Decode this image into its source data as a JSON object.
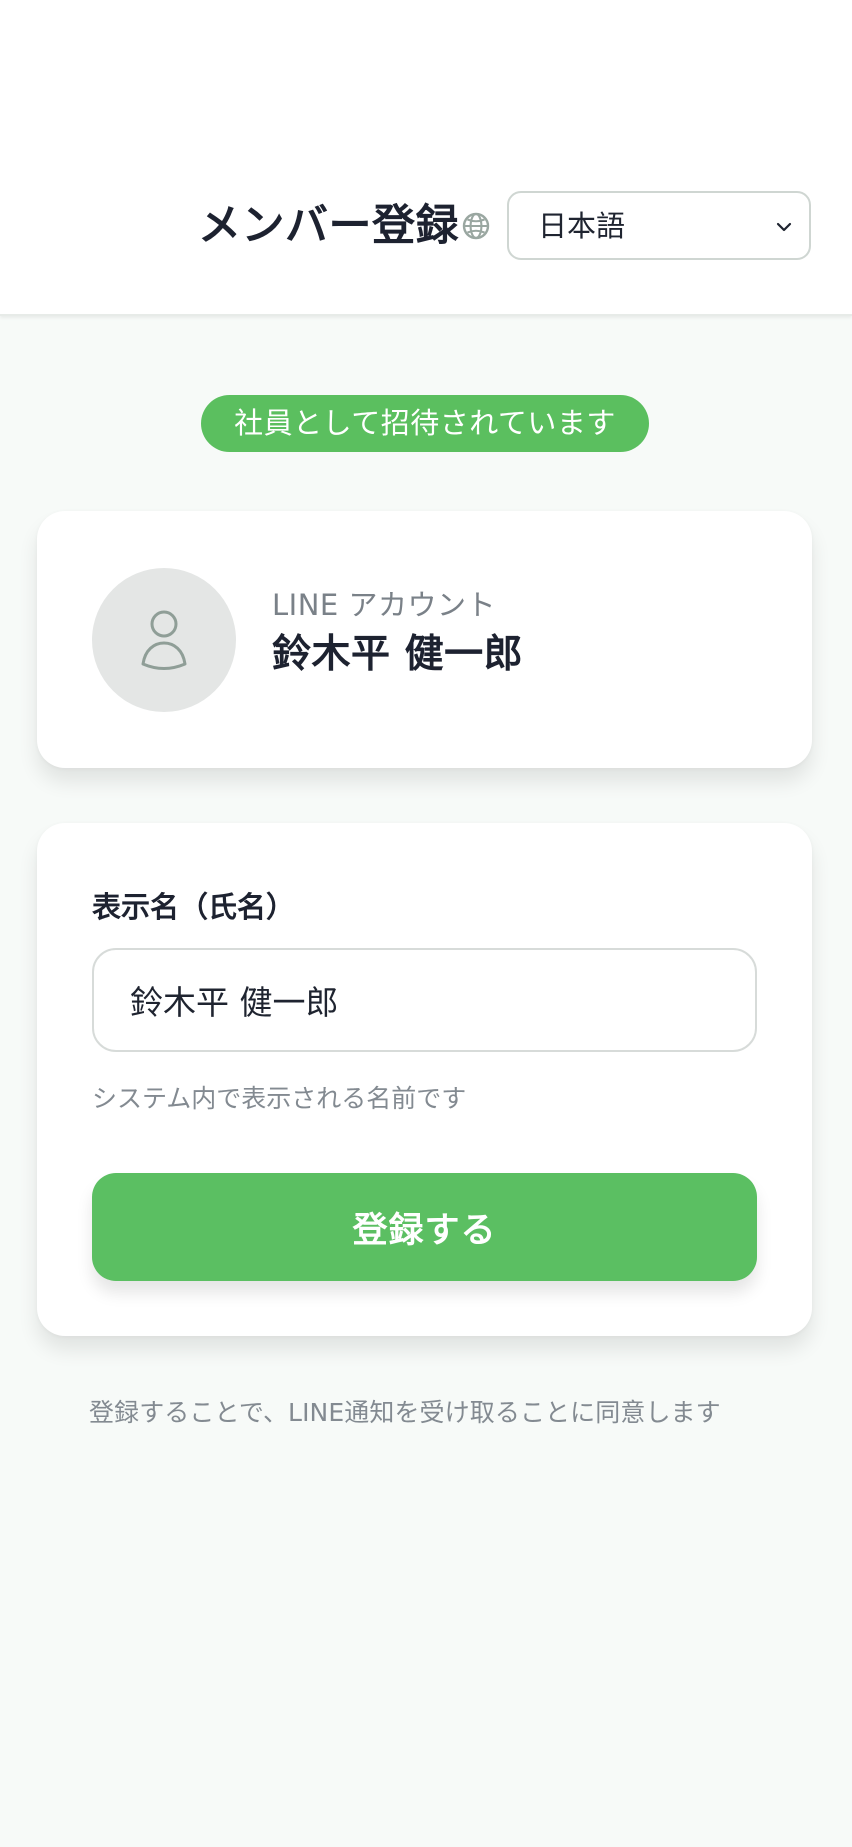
{
  "header": {
    "title": "メンバー登録",
    "language_icon": "globe-icon",
    "language_value": "日本語",
    "language_dropdown_icon": "chevron-down-icon"
  },
  "invite": {
    "badge": "社員として招待されています"
  },
  "account": {
    "avatar_icon": "user-icon",
    "label": "LINE アカウント",
    "name": "鈴木平 健一郎"
  },
  "form": {
    "field_label": "表示名（氏名）",
    "name_value": "鈴木平 健一郎",
    "help_text": "システム内で表示される名前です",
    "submit_label": "登録する"
  },
  "footer": {
    "consent": "登録することで、LINE通知を受け取ることに同意します"
  },
  "colors": {
    "accent": "#5bbf62",
    "badge": "#5bbf5f",
    "background": "#f7faf8",
    "text": "#1d2230",
    "muted_text": "#838a91"
  }
}
